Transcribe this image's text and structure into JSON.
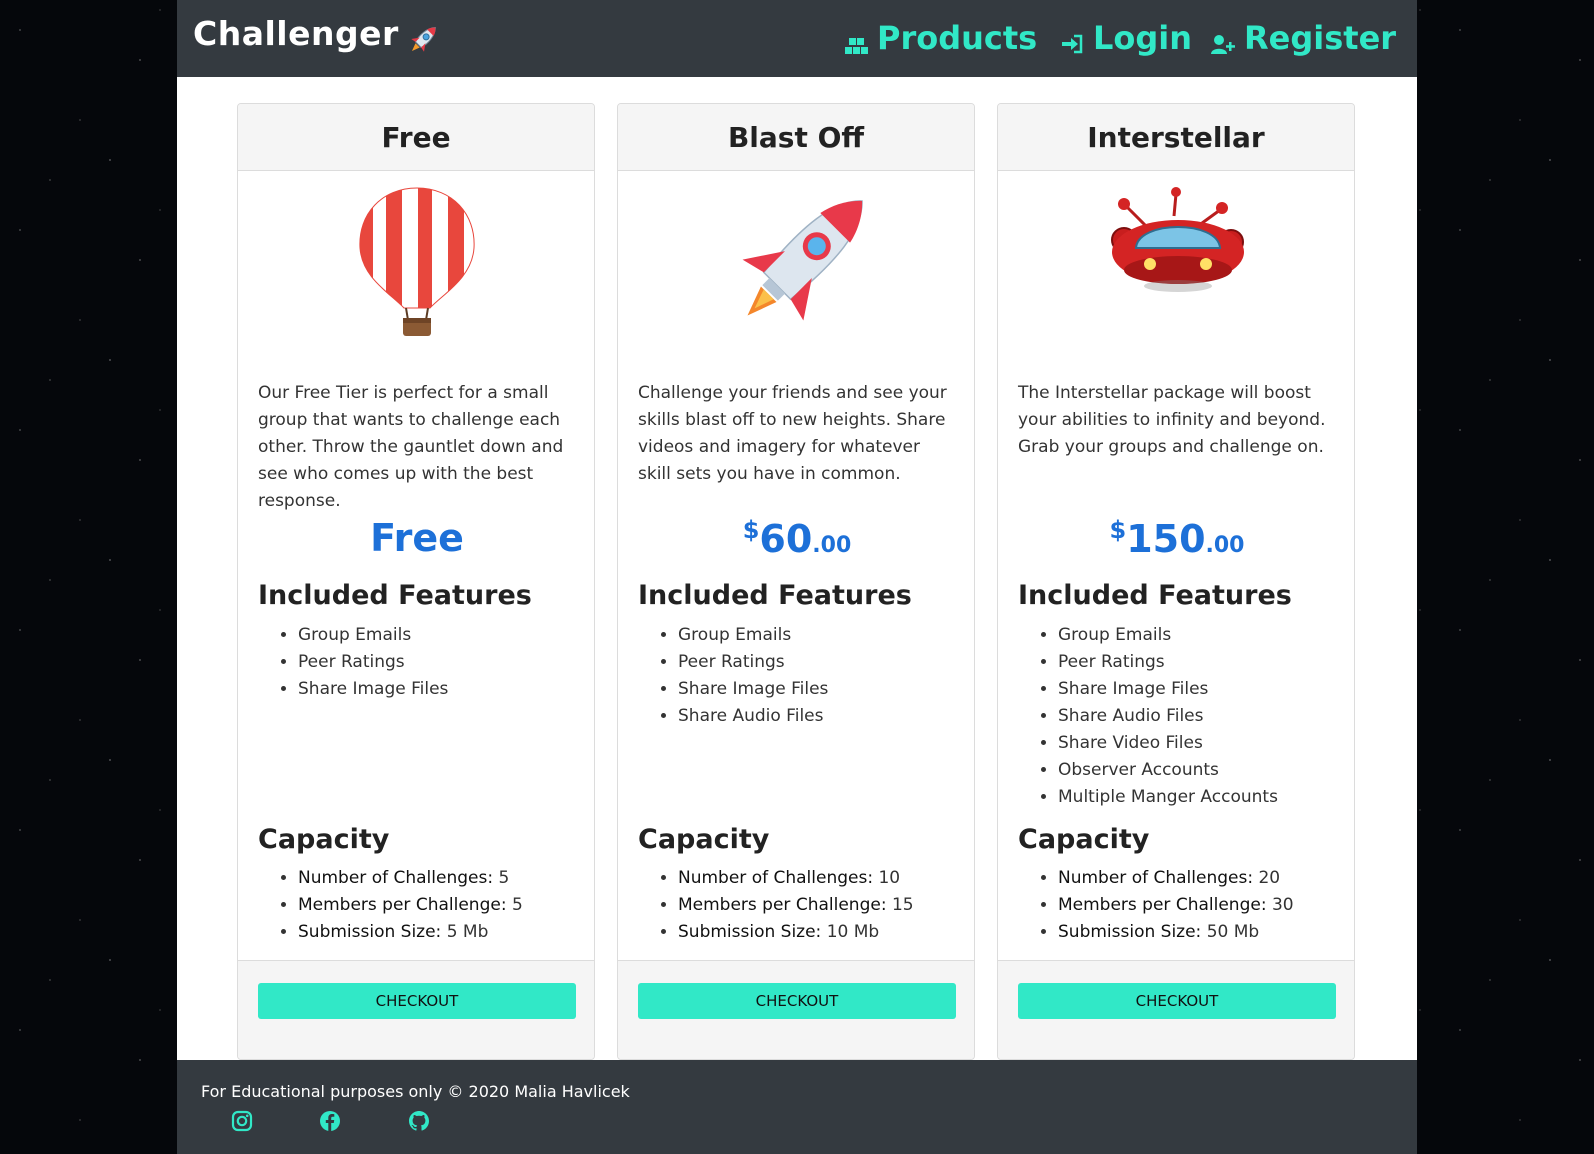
{
  "navbar": {
    "brand": "Challenger",
    "brand_icon": "rocket-icon",
    "links": [
      {
        "label": "Products",
        "icon": "boxes-icon"
      },
      {
        "label": "Login",
        "icon": "sign-in-icon"
      },
      {
        "label": "Register",
        "icon": "user-plus-icon"
      }
    ],
    "link_color": "#31e8c7",
    "background": "#343a40"
  },
  "plans": [
    {
      "name": "Free",
      "image": "hot-air-balloon",
      "description": "Our Free Tier is perfect for a small group that wants to challenge each other. Throw the gauntlet down and see who comes up with the best response.",
      "price_text": "Free",
      "features_title": "Included Features",
      "features": [
        "Group Emails",
        "Peer Ratings",
        "Share Image Files"
      ],
      "capacity_title": "Capacity",
      "capacity": [
        {
          "label": "Number of Challenges:",
          "value": "5"
        },
        {
          "label": "Members per Challenge:",
          "value": "5"
        },
        {
          "label": "Submission Size:",
          "value": "5 Mb"
        }
      ],
      "button": "CHECKOUT"
    },
    {
      "name": "Blast Off",
      "image": "rocket",
      "description": "Challenge your friends and see your skills blast off to new heights. Share videos and imagery for whatever skill sets you have in common.",
      "price_currency": "$",
      "price_whole": "60",
      "price_cents": ".00",
      "features_title": "Included Features",
      "features": [
        "Group Emails",
        "Peer Ratings",
        "Share Image Files",
        "Share Audio Files"
      ],
      "capacity_title": "Capacity",
      "capacity": [
        {
          "label": "Number of Challenges:",
          "value": "10"
        },
        {
          "label": "Members per Challenge:",
          "value": "15"
        },
        {
          "label": "Submission Size:",
          "value": "10 Mb"
        }
      ],
      "button": "CHECKOUT"
    },
    {
      "name": "Interstellar",
      "image": "flying-saucer",
      "description": "The Interstellar package will boost your abilities to infinity and beyond. Grab your groups and challenge on.",
      "price_currency": "$",
      "price_whole": "150",
      "price_cents": ".00",
      "features_title": "Included Features",
      "features": [
        "Group Emails",
        "Peer Ratings",
        "Share Image Files",
        "Share Audio Files",
        "Share Video Files",
        "Observer Accounts",
        "Multiple Manger Accounts"
      ],
      "capacity_title": "Capacity",
      "capacity": [
        {
          "label": "Number of Challenges:",
          "value": "20"
        },
        {
          "label": "Members per Challenge:",
          "value": "30"
        },
        {
          "label": "Submission Size:",
          "value": "50 Mb"
        }
      ],
      "button": "CHECKOUT"
    }
  ],
  "price_color": "#1d70d8",
  "button_color": "#31e8c7",
  "footer": {
    "text": "For Educational purposes only © 2020 Malia Havlicek",
    "social": [
      "instagram-icon",
      "facebook-icon",
      "github-icon"
    ]
  }
}
